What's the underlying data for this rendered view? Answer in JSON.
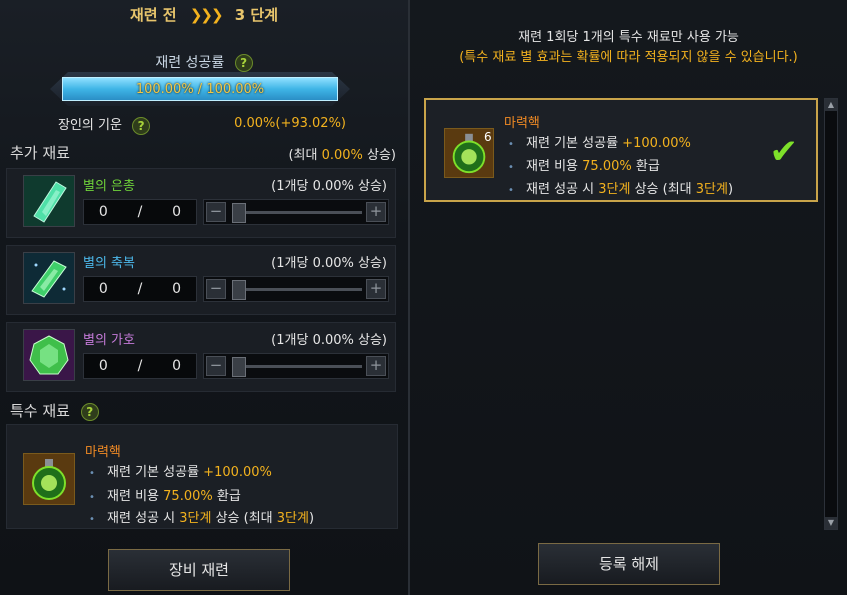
{
  "left": {
    "stage_before": "재련 전",
    "stage_arrows": "❯❯❯",
    "stage_after": "3 단계",
    "success_rate_label": "재련 성공률",
    "success_rate_value": "100.00% / 100.00%",
    "artisan_label": "장인의 기운",
    "artisan_value": "0.00%(+93.02%)",
    "extra_title": "추가 재료",
    "extra_max_prefix": "(최대 ",
    "extra_max_value": "0.00%",
    "extra_max_suffix": " 상승)",
    "materials": [
      {
        "name": "별의 은총",
        "color": "#6fd23a",
        "increase": "(1개당 0.00% 상승)",
        "qty": "0",
        "sep": "/",
        "max": "0"
      },
      {
        "name": "별의 축복",
        "color": "#4cb8ea",
        "increase": "(1개당 0.00% 상승)",
        "qty": "0",
        "sep": "/",
        "max": "0"
      },
      {
        "name": "별의 가호",
        "color": "#c47ad8",
        "increase": "(1개당 0.00% 상승)",
        "qty": "0",
        "sep": "/",
        "max": "0"
      }
    ],
    "special_title": "특수 재료",
    "special": {
      "name": "마력핵",
      "line1_pre": "재련 기본 성공률 ",
      "line1_hl": "+100.00%",
      "line2_pre": "재련 비용 ",
      "line2_hl": "75.00%",
      "line2_post": " 환급",
      "line3_pre": "재련 성공 시 ",
      "line3_hl1": "3단계",
      "line3_mid": " 상승 (최대 ",
      "line3_hl2": "3단계",
      "line3_post": ")"
    },
    "equip_button": "장비 재련",
    "help_symbol": "?",
    "minus": "−",
    "plus": "+"
  },
  "right": {
    "notice_line1": "재련 1회당 1개의 특수 재료만 사용 가능",
    "notice_line2": "(특수 재료 별 효과는 확률에 따라 적용되지 않을 수 있습니다.)",
    "card": {
      "count": "6",
      "name": "마력핵",
      "line1_pre": "재련 기본 성공률 ",
      "line1_hl": "+100.00%",
      "line2_pre": "재련 비용 ",
      "line2_hl": "75.00%",
      "line2_post": " 환급",
      "line3_pre": "재련 성공 시 ",
      "line3_hl1": "3단계",
      "line3_mid": " 상승 (최대 ",
      "line3_hl2": "3단계",
      "line3_post": ")",
      "check_symbol": "✔"
    },
    "unregister_button": "등록 해제",
    "scroll_up": "▲",
    "scroll_down": "▼"
  },
  "colors": {
    "accent_gold": "#f3b21e",
    "special_name": "#f08a24",
    "rate_bar": "#3fb5e6",
    "selected_border": "#c9a44a",
    "check": "#7ee02a"
  },
  "icons": [
    "help-icon",
    "star-grace-icon",
    "star-blessing-icon",
    "star-protection-icon",
    "mana-core-icon",
    "checkmark-icon"
  ]
}
